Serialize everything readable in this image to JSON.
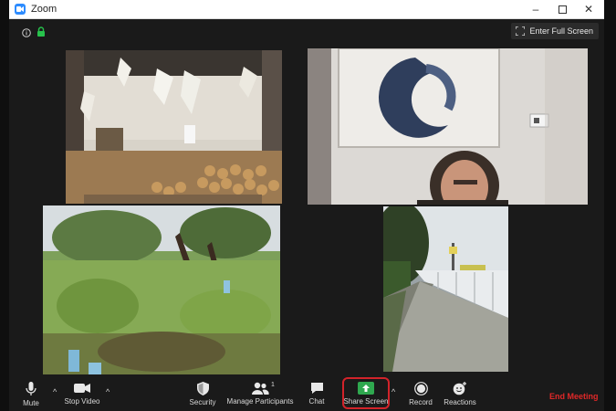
{
  "window": {
    "title": "Zoom"
  },
  "header": {
    "fullscreen_label": "Enter Full Screen"
  },
  "toolbar": {
    "mute": "Mute",
    "stop_video": "Stop Video",
    "security": "Security",
    "participants": "Manage Participants",
    "participants_count": "1",
    "chat": "Chat",
    "share": "Share Screen",
    "record": "Record",
    "reactions": "Reactions",
    "end": "End Meeting"
  },
  "colors": {
    "share_green": "#2fa84f",
    "end_red": "#e02828",
    "highlight": "#d2232a",
    "zoom_blue": "#2d8cff"
  }
}
